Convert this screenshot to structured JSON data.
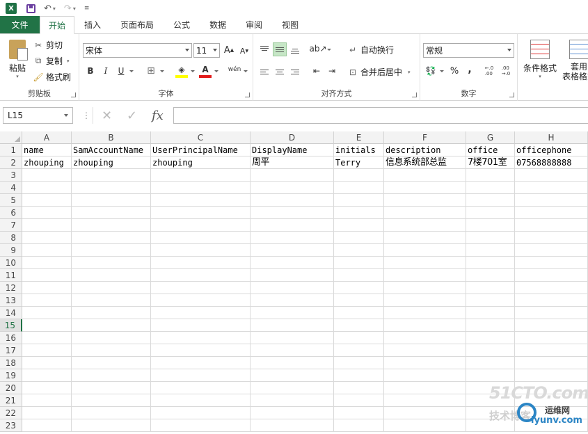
{
  "tabs": [
    {
      "label": "文件"
    },
    {
      "label": "开始"
    },
    {
      "label": "插入"
    },
    {
      "label": "页面布局"
    },
    {
      "label": "公式"
    },
    {
      "label": "数据"
    },
    {
      "label": "审阅"
    },
    {
      "label": "视图"
    }
  ],
  "ribbon": {
    "clipboard": {
      "label": "剪贴板",
      "paste": "粘贴",
      "cut": "剪切",
      "copy": "复制",
      "format_painter": "格式刷"
    },
    "font": {
      "label": "字体",
      "family": "宋体",
      "size": "11",
      "bold": "B",
      "italic": "I",
      "underline": "U",
      "phonetic": "wén"
    },
    "alignment": {
      "label": "对齐方式",
      "wrap_text": "自动换行",
      "merge_center": "合并后居中"
    },
    "number": {
      "label": "数字",
      "format": "常规",
      "percent": "%",
      "comma": ","
    },
    "styles": {
      "conditional": "条件格式",
      "table_format_1": "套用",
      "table_format_2": "表格格式"
    }
  },
  "formula_bar": {
    "name_box": "L15",
    "fx": "fx",
    "dots": "⋮",
    "value": ""
  },
  "sheet": {
    "columns": [
      "A",
      "B",
      "C",
      "D",
      "E",
      "F",
      "G",
      "H"
    ],
    "rows": [
      "1",
      "2",
      "3",
      "4",
      "5",
      "6",
      "7",
      "8",
      "9",
      "10",
      "11",
      "12",
      "13",
      "14",
      "15",
      "16",
      "17",
      "18",
      "19",
      "20",
      "21",
      "22",
      "23"
    ],
    "selected_row": "15",
    "header_row": [
      "name",
      "SamAccountName",
      "UserPrincipalName",
      "DisplayName",
      "initials",
      "description",
      "office",
      "officephone"
    ],
    "data_row": [
      "zhouping",
      "zhouping",
      "zhouping",
      "周平",
      "Terry",
      "信息系统部总监",
      "7楼701室",
      "07568888888"
    ]
  },
  "colors": {
    "accent": "#217346",
    "selection": "#c6e6c6"
  }
}
